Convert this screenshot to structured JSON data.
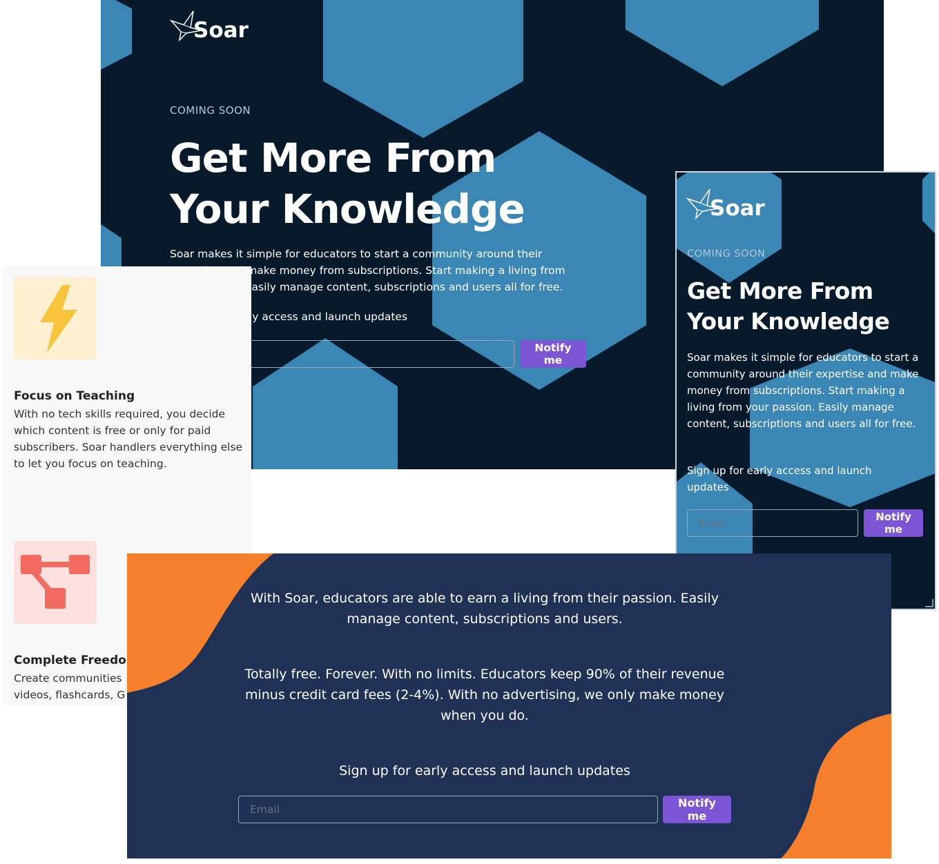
{
  "desktop": {
    "logo_text": "Soar",
    "kicker": "COMING SOON",
    "headline_line1": "Get More From",
    "headline_line2": "Your Knowledge",
    "description": "Soar makes it simple for educators to start a community around their expertise and make money from subscriptions. Start making a living from your passion. Easily manage content, subscriptions and users all for free.",
    "signup_prompt": "Sign up for early access and launch updates",
    "email_placeholder": "",
    "notify_label": "Notify me"
  },
  "mobile": {
    "logo_text": "Soar",
    "kicker": "COMING SOON",
    "headline_line1": "Get More From",
    "headline_line2": "Your Knowledge",
    "description": "Soar makes it simple for educators to start a community around their expertise and make money from subscriptions. Start making a living from your passion. Easily manage content, subscriptions and users all for free.",
    "signup_prompt": "Sign up for early access and launch updates",
    "email_placeholder": "Email",
    "notify_label": "Notify me"
  },
  "features": [
    {
      "icon": "lightning-icon",
      "title": "Focus on Teaching",
      "description": "With no tech skills required, you decide which content is free or only for paid subscribers. Soar handlers everything else to let you focus on teaching."
    },
    {
      "icon": "flowchart-icon",
      "title": "Complete Freedom",
      "description": "Create communities videos, flashcards, G"
    }
  ],
  "cta": {
    "paragraph1": "With Soar, educators are able to earn a living from their passion. Easily manage content, subscriptions and users.",
    "paragraph2": "Totally free. Forever. With no limits. Educators keep 90% of their revenue minus credit card fees (2-4%). With no advertising, we only make money when you do.",
    "signup_prompt": "Sign up for early access and launch updates",
    "email_placeholder": "Email",
    "notify_label": "Notify me"
  },
  "colors": {
    "dark_navy": "#071a2b",
    "hex_blue": "#3a86b4",
    "cta_navy": "#1f3256",
    "accent_orange": "#f57f2a",
    "button_purple": "#7b55d4"
  }
}
